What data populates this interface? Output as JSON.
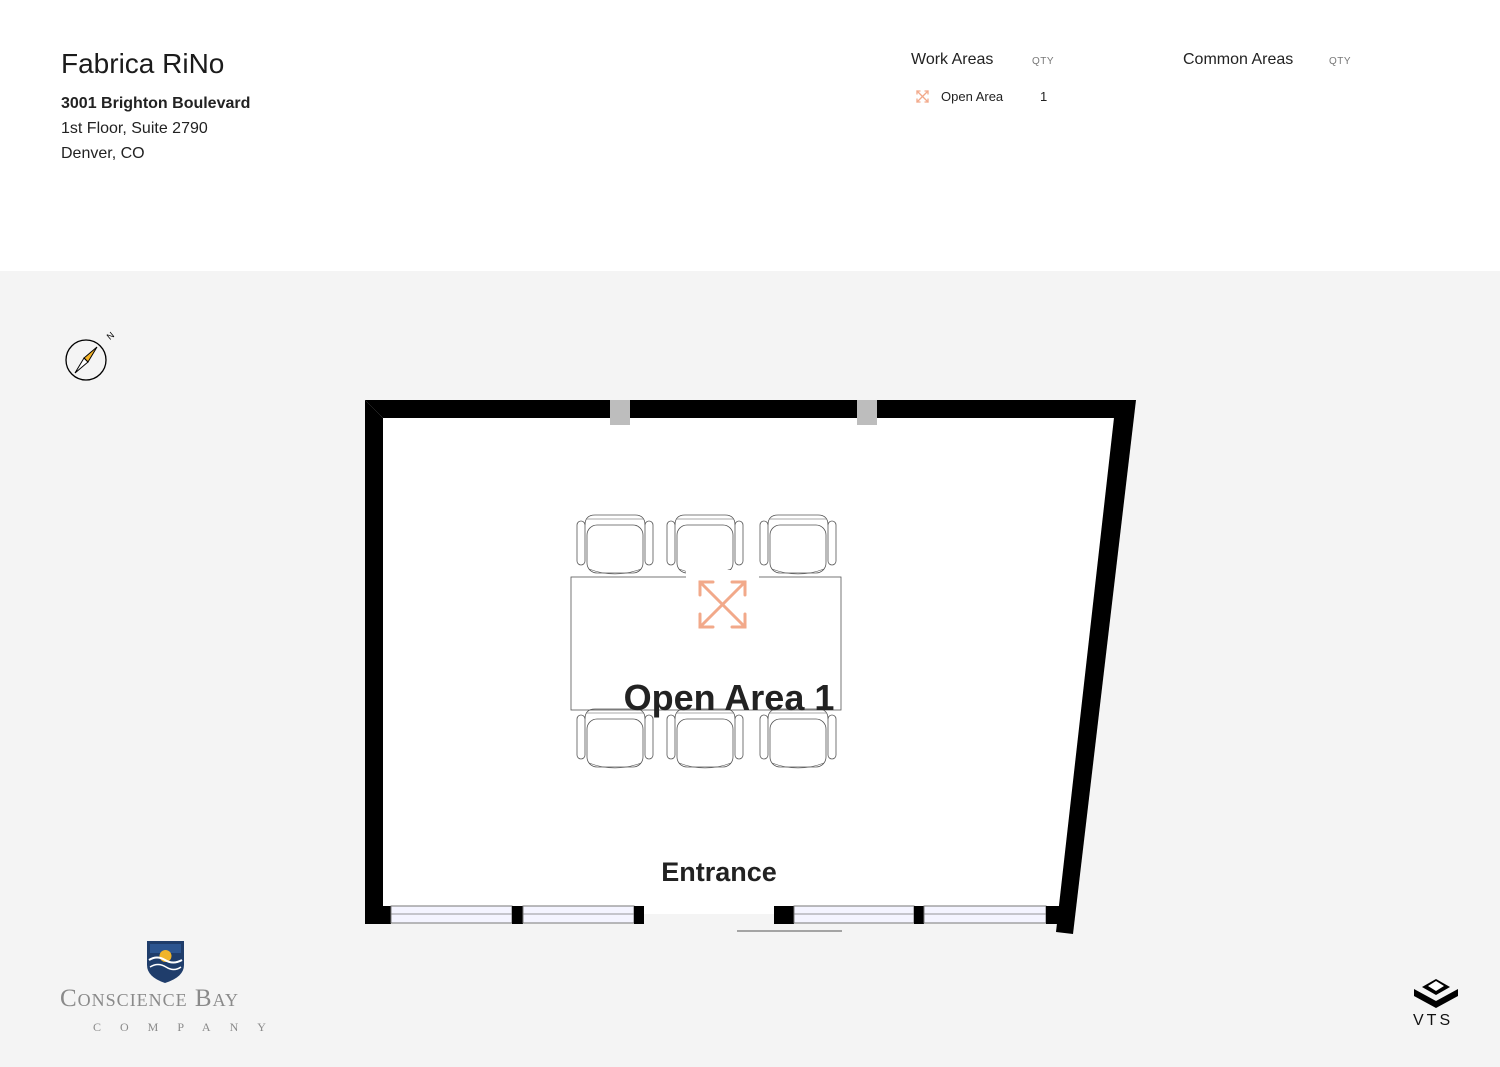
{
  "property": {
    "name": "Fabrica RiNo",
    "address_line1": "3001 Brighton Boulevard",
    "address_line2": "1st Floor, Suite 2790",
    "address_line3": "Denver, CO"
  },
  "legend": {
    "work_areas": {
      "heading": "Work Areas",
      "qty_label": "QTY",
      "items": [
        {
          "label": "Open Area",
          "qty": "1",
          "icon": "expand-arrows-icon",
          "color": "#f2a98a"
        }
      ]
    },
    "common_areas": {
      "heading": "Common Areas",
      "qty_label": "QTY",
      "items": []
    }
  },
  "floorplan": {
    "rooms": [
      {
        "label": "Open Area 1",
        "type": "Open Area"
      }
    ],
    "entrance_label": "Entrance",
    "compass_label": "N",
    "chairs": 6,
    "colors": {
      "wall": "#000000",
      "column": "#bdbdbd",
      "room_icon": "#f2a98a",
      "floor": "#ffffff"
    }
  },
  "branding": {
    "company_name": "Conscience Bay",
    "company_sub": "COMPANY",
    "platform": "VTS"
  }
}
